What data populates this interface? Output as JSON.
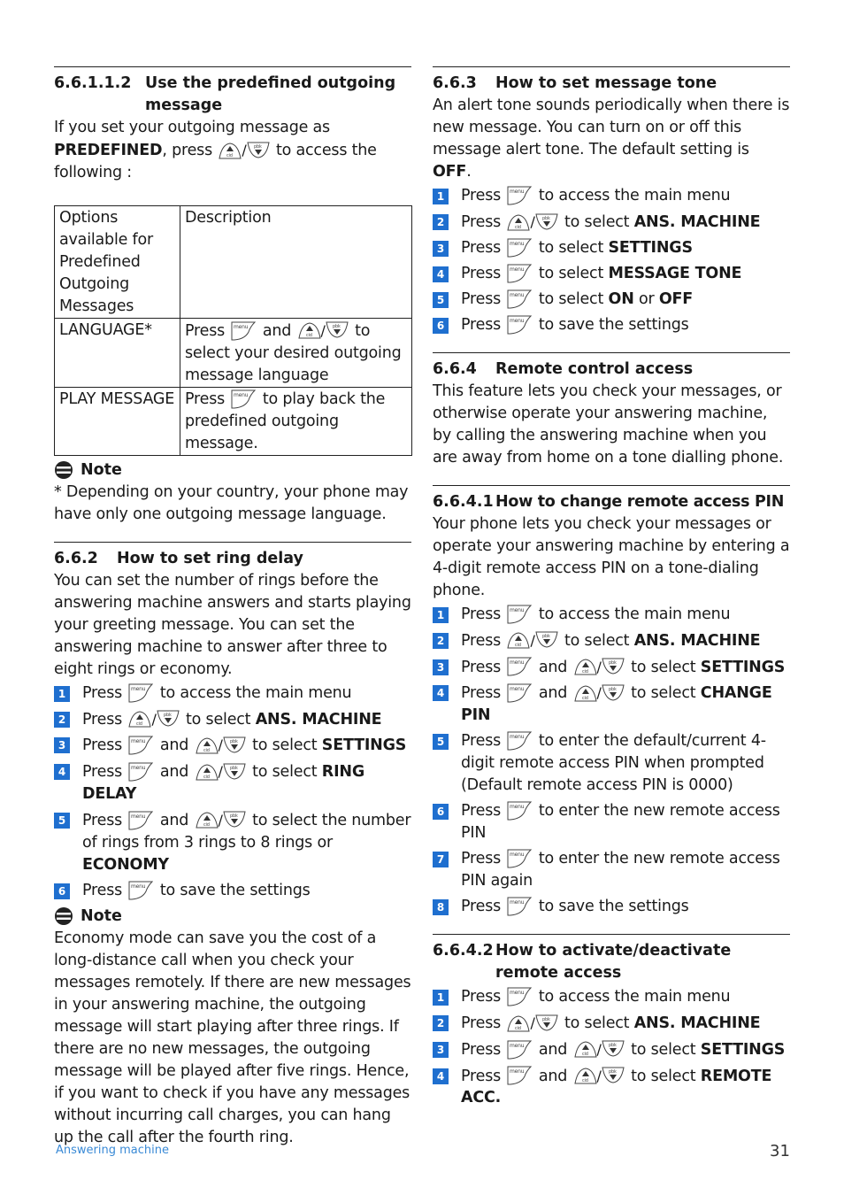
{
  "colors": {
    "badge": "#1f6fcf",
    "footer_text": "#3a8ad6"
  },
  "left": {
    "s1": {
      "number": "6.6.1.1.2",
      "title_line1": "Use the predefined outgoing",
      "title_line2": "message",
      "p1": "If you set your outgoing message as",
      "p2_bold": "PREDEFINED",
      "p2_a": ", press",
      "p2_b": "to access the",
      "p3": "following :",
      "table": {
        "header": [
          "Options available for Predefined Outgoing Messages",
          "Description"
        ],
        "rows": [
          {
            "option": "LANGUAGE*",
            "press": "Press",
            "and": "and",
            "to": "to",
            "rest": "select your desired outgoing message language"
          },
          {
            "option": "PLAY MESSAGE",
            "press": "Press",
            "rest": "to play back the predefined outgoing message."
          }
        ]
      },
      "note_label": "Note",
      "note_text": "* Depending on your country, your phone may have only one outgoing message language."
    },
    "s2": {
      "number": "6.6.2",
      "title": "How to set ring delay",
      "body": "You can set the number of rings before the answering machine answers and starts playing your greeting message. You can set the answering machine to answer after three to eight rings or economy.",
      "steps": [
        {
          "n": "1",
          "press": "Press",
          "text": "to access the main menu"
        },
        {
          "n": "2",
          "press": "Press",
          "text": "to select ",
          "bold": "ANS. MACHINE"
        },
        {
          "n": "3",
          "press": "Press",
          "and": "and",
          "text": "to select ",
          "bold": "SETTINGS"
        },
        {
          "n": "4",
          "press": "Press",
          "and": "and",
          "text": "to select ",
          "bold": "RING DELAY"
        },
        {
          "n": "5",
          "press": "Press",
          "and": "and",
          "text": "to select the number of rings from 3 rings to 8 rings or ",
          "bold": "ECONOMY"
        },
        {
          "n": "6",
          "press": "Press",
          "text": "to save the settings"
        }
      ],
      "note_label": "Note",
      "note_text": "Economy mode can save you the cost of a long-distance call when you check your messages remotely. If there are new messages in your answering machine, the outgoing message will start playing after three rings. If there are no new messages, the outgoing message will be played after five rings. Hence, if you want to check if you have any messages without incurring call charges, you can hang up the call after the fourth ring."
    }
  },
  "right": {
    "s3": {
      "number": "6.6.3",
      "title": "How to set message tone",
      "body": "An alert tone sounds periodically when there is new message. You can turn on or off this message alert tone. The default setting is ",
      "body_bold": "OFF",
      "body_end": ".",
      "steps": [
        {
          "n": "1",
          "press": "Press",
          "text": "to access the main menu"
        },
        {
          "n": "2",
          "press": "Press",
          "text": "to select ",
          "bold": "ANS. MACHINE"
        },
        {
          "n": "3",
          "press": "Press",
          "text": "to select ",
          "bold": "SETTINGS"
        },
        {
          "n": "4",
          "press": "Press",
          "text": "to select ",
          "bold": "MESSAGE TONE"
        },
        {
          "n": "5",
          "press": "Press",
          "text": "to select ",
          "bold": "ON",
          "mid": " or ",
          "bold2": "OFF"
        },
        {
          "n": "6",
          "press": "Press",
          "text": "to save the settings"
        }
      ]
    },
    "s4": {
      "number": "6.6.4",
      "title": "Remote control access",
      "body": "This feature lets you check your messages, or otherwise operate your answering machine, by calling the answering machine when you are away from home on a tone dialling phone."
    },
    "s41": {
      "number": "6.6.4.1",
      "title": "How to change remote access PIN",
      "body": "Your phone lets you check your messages or operate your answering machine by entering a 4-digit remote access PIN on a tone-dialing phone.",
      "steps": [
        {
          "n": "1",
          "press": "Press",
          "text": "to access the main menu"
        },
        {
          "n": "2",
          "press": "Press",
          "text": "to select ",
          "bold": "ANS. MACHINE"
        },
        {
          "n": "3",
          "press": "Press",
          "and": "and",
          "text": "to select ",
          "bold": "SETTINGS"
        },
        {
          "n": "4",
          "press": "Press",
          "and": "and",
          "text": "to select ",
          "bold": "CHANGE PIN"
        },
        {
          "n": "5",
          "press": "Press",
          "text": "to enter the default/current 4-digit remote access PIN when prompted (Default remote access PIN is 0000)"
        },
        {
          "n": "6",
          "press": "Press",
          "text": "to enter the new remote access PIN"
        },
        {
          "n": "7",
          "press": "Press",
          "text": "to enter the new remote access PIN again"
        },
        {
          "n": "8",
          "press": "Press",
          "text": "to save the settings"
        }
      ]
    },
    "s42": {
      "number": "6.6.4.2",
      "title_line1": "How to activate/deactivate",
      "title_line2": "remote access",
      "steps": [
        {
          "n": "1",
          "press": "Press",
          "text": "to access the main menu"
        },
        {
          "n": "2",
          "press": "Press",
          "text": "to select ",
          "bold": "ANS. MACHINE"
        },
        {
          "n": "3",
          "press": "Press",
          "and": "and",
          "text": "to select ",
          "bold": "SETTINGS"
        },
        {
          "n": "4",
          "press": "Press",
          "and": "and",
          "text": "to select ",
          "bold": "REMOTE ACC."
        }
      ]
    }
  },
  "icons": {
    "menu_key": "menu-key-icon",
    "up_key": "cid-up-key-icon",
    "down_key": "pbk-down-key-icon",
    "note": "note-icon"
  },
  "footer": {
    "section": "Answering machine",
    "page": "31"
  }
}
